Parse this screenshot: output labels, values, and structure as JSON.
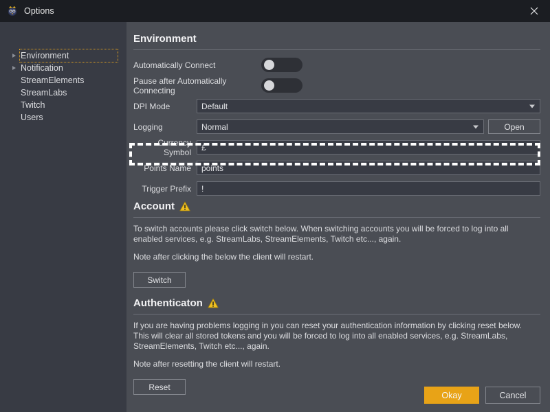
{
  "window": {
    "title": "Options",
    "app_icon": "owl-mascot-icon",
    "close_icon": "close-icon"
  },
  "sidebar": {
    "items": [
      {
        "label": "Environment",
        "expandable": true,
        "selected": true
      },
      {
        "label": "Notification",
        "expandable": true,
        "selected": false
      },
      {
        "label": "StreamElements",
        "expandable": false,
        "selected": false
      },
      {
        "label": "StreamLabs",
        "expandable": false,
        "selected": false
      },
      {
        "label": "Twitch",
        "expandable": false,
        "selected": false
      },
      {
        "label": "Users",
        "expandable": false,
        "selected": false
      }
    ]
  },
  "environment": {
    "heading": "Environment",
    "auto_connect": {
      "label": "Automatically Connect",
      "state": "off"
    },
    "pause_after": {
      "label": "Pause after Automatically Connecting",
      "state": "off"
    },
    "dpi_mode": {
      "label": "DPI Mode",
      "value": "Default"
    },
    "logging": {
      "label": "Logging",
      "value": "Normal",
      "button": "Open"
    },
    "currency_symbol": {
      "label": "Currency Symbol",
      "value": "£"
    },
    "points_name": {
      "label": "Points Name",
      "value": "points"
    },
    "trigger_prefix": {
      "label": "Trigger Prefix",
      "value": "!"
    }
  },
  "account": {
    "heading": "Account",
    "warning_icon": "warning-triangle-icon",
    "paragraph1": "To switch accounts please click switch below. When switching accounts you will be forced to log into all enabled services, e.g. StreamLabs, StreamElements, Twitch etc..., again.",
    "paragraph2": "Note after clicking the below the client will restart.",
    "button": "Switch"
  },
  "authentication": {
    "heading": "Authenticaton",
    "warning_icon": "warning-triangle-icon",
    "paragraph1": "If you are having problems logging in you can reset your authentication information by clicking reset below. This will clear all stored tokens and you will be forced to log into all enabled services, e.g. StreamLabs, StreamElements, Twitch etc..., again.",
    "paragraph2": "Note after resetting the client will restart.",
    "button": "Reset"
  },
  "footer": {
    "okay": "Okay",
    "cancel": "Cancel"
  },
  "colors": {
    "accent": "#e8a317",
    "titlebar": "#1b1d22",
    "sidebar": "#383b44",
    "panel": "#4a4d54",
    "highlight": "#ffffff",
    "selection_outline": "#e0a020"
  }
}
